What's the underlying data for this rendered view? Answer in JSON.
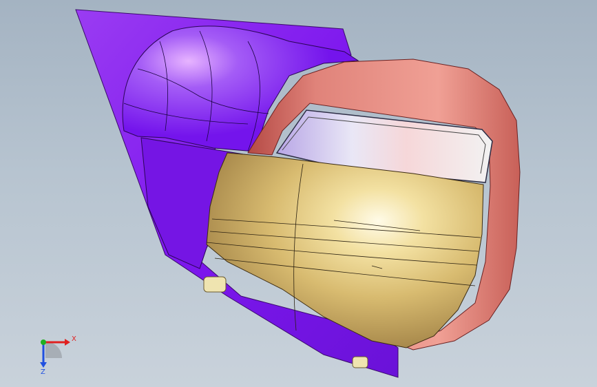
{
  "viewport": {
    "background_top": "#a4b3c2",
    "background_bottom": "#c9d2db"
  },
  "model": {
    "parts": [
      {
        "name": "mirror-base-housing",
        "color": "#8a1fe8"
      },
      {
        "name": "mirror-shell-upper",
        "color": "#7a1af0"
      },
      {
        "name": "mirror-bezel-frame",
        "color": "#e07f75"
      },
      {
        "name": "turn-signal-lens",
        "color": "#d9dbef"
      },
      {
        "name": "mirror-cover-lower",
        "color": "#e8cf86"
      },
      {
        "name": "mounting-tab",
        "color": "#efe4b0"
      }
    ]
  },
  "triad": {
    "x_label": "X",
    "z_label": "Z",
    "x_color": "#e02020",
    "y_color": "#20b020",
    "z_color": "#2050e0"
  }
}
